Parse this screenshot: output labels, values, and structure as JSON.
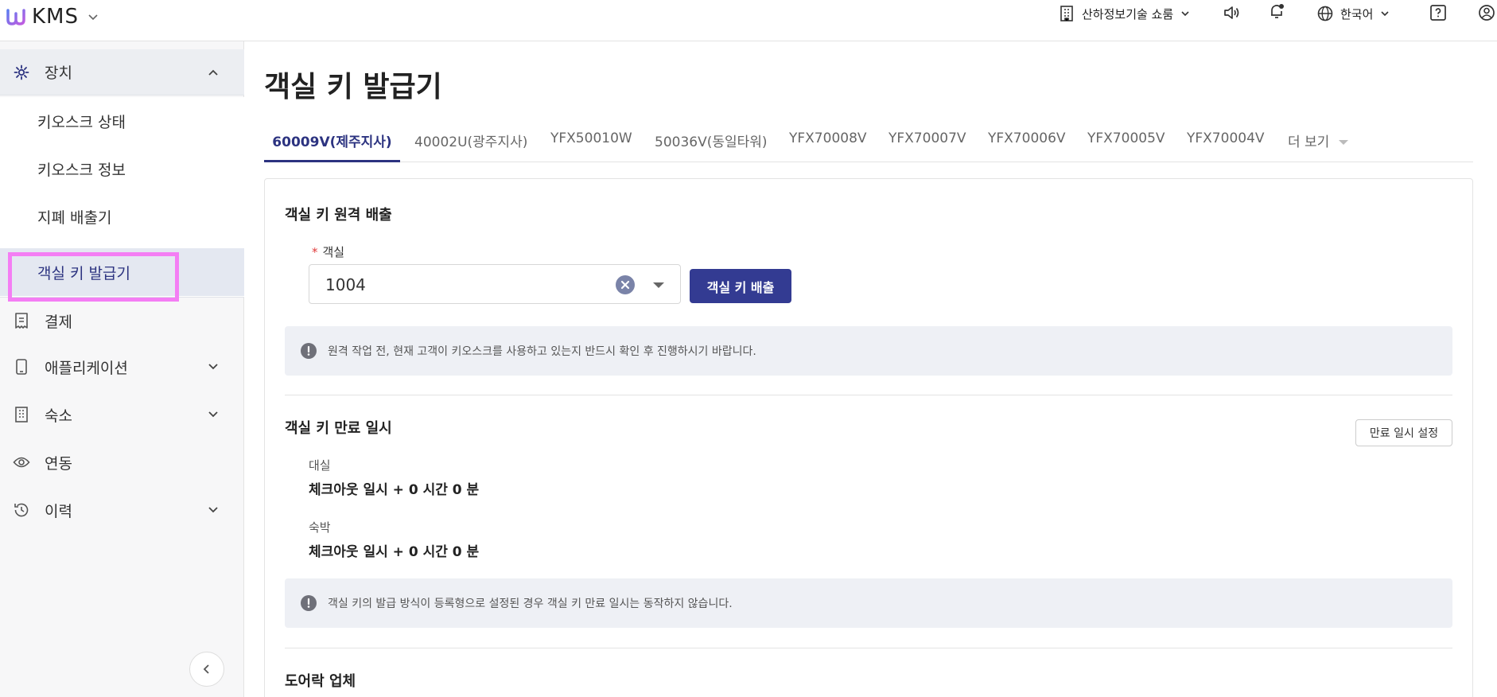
{
  "app": {
    "name": "KMS"
  },
  "header": {
    "property": "산하정보기술 쇼룸",
    "language": "한국어"
  },
  "sidebar": {
    "groups": [
      {
        "label": "장치",
        "icon": "gear-icon",
        "expanded": true
      },
      {
        "label": "결제",
        "icon": "receipt-icon"
      },
      {
        "label": "애플리케이션",
        "icon": "tablet-icon"
      },
      {
        "label": "숙소",
        "icon": "building-icon"
      },
      {
        "label": "연동",
        "icon": "eye-icon"
      },
      {
        "label": "이력",
        "icon": "history-icon"
      }
    ],
    "sub_items": [
      {
        "label": "키오스크 상태"
      },
      {
        "label": "키오스크 정보"
      },
      {
        "label": "지폐 배출기"
      },
      {
        "label": "객실 키 발급기",
        "active": true
      }
    ]
  },
  "page": {
    "title": "객실 키 발급기"
  },
  "tabs": [
    {
      "label": "60009V(제주지사)",
      "active": true
    },
    {
      "label": "40002U(광주지사)"
    },
    {
      "label": "YFX50010W"
    },
    {
      "label": "50036V(동일타워)"
    },
    {
      "label": "YFX70008V"
    },
    {
      "label": "YFX70007V"
    },
    {
      "label": "YFX70006V"
    },
    {
      "label": "YFX70005V"
    },
    {
      "label": "YFX70004V"
    },
    {
      "label": "더 보기"
    }
  ],
  "remote_dispense": {
    "title": "객실 키 원격 배출",
    "room_label": "객실",
    "required_mark": "*",
    "room_value": "1004",
    "button": "객실 키 배출",
    "notice": "원격 작업 전, 현재 고객이 키오스크를 사용하고 있는지 반드시 확인 후 진행하시기 바랍니다."
  },
  "expiry": {
    "title": "객실 키 만료 일시",
    "button": "만료 일시 설정",
    "rental_label": "대실",
    "rental_value": "체크아웃 일시 + 0 시간 0 분",
    "stay_label": "숙박",
    "stay_value": "체크아웃 일시 + 0 시간 0 분",
    "notice": "객실 키의 발급 방식이 등록형으로 설정된 경우 객실 키 만료 일시는 동작하지 않습니다."
  },
  "doorlock": {
    "title": "도어락 업체"
  },
  "colors": {
    "primary": "#333b92",
    "highlight": "#f47ef4",
    "active_text": "#2c3380"
  }
}
